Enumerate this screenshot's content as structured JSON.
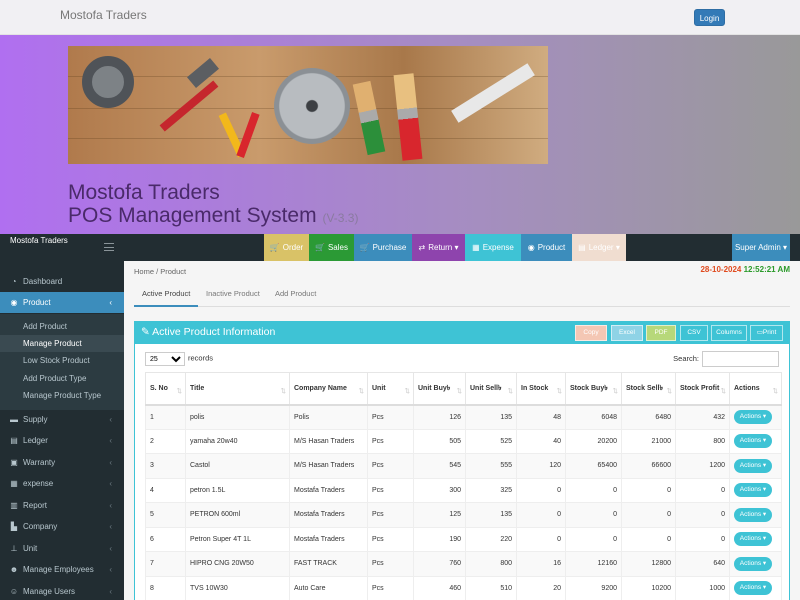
{
  "topbar": {
    "brand": "Mostofa Traders",
    "login_label": "Login"
  },
  "banner": {
    "title_line1": "Mostofa Traders",
    "title_line2": "POS Management System",
    "version": "(V-3.3)"
  },
  "navbar": {
    "app_name": "Mostofa Traders",
    "buttons": [
      {
        "label": "Order",
        "icon": "cart-icon",
        "color": "#d9c267"
      },
      {
        "label": "Sales",
        "icon": "cart-icon",
        "color": "#2b9a35"
      },
      {
        "label": "Purchase",
        "icon": "cart-icon",
        "color": "#3c8dbc"
      },
      {
        "label": "Return",
        "icon": "exchange-icon",
        "color": "#8e44ad"
      },
      {
        "label": "Expense",
        "icon": "calculator-icon",
        "color": "#3ec3d5"
      },
      {
        "label": "Product",
        "icon": "cube-icon",
        "color": "#3c8dbc"
      },
      {
        "label": "Ledger",
        "icon": "book-icon",
        "color": "#f0ddd0"
      }
    ],
    "user_label": "Super Admin"
  },
  "sidebar": {
    "items": [
      {
        "label": "Dashboard",
        "icon": "dashboard-icon"
      },
      {
        "label": "Product",
        "icon": "cube-icon"
      },
      {
        "label": "Supply",
        "icon": "truck-icon"
      },
      {
        "label": "Ledger",
        "icon": "book-icon"
      },
      {
        "label": "Warranty",
        "icon": "shield-icon"
      },
      {
        "label": "expense",
        "icon": "calculator-icon"
      },
      {
        "label": "Report",
        "icon": "chart-icon"
      },
      {
        "label": "Company",
        "icon": "building-icon"
      },
      {
        "label": "Unit",
        "icon": "unit-icon"
      },
      {
        "label": "Manage Employees",
        "icon": "users-icon"
      },
      {
        "label": "Manage Users",
        "icon": "user-icon"
      }
    ],
    "sub_items": [
      "Add Product",
      "Manage Product",
      "Low Stock Product",
      "Add Product Type",
      "Manage Product Type"
    ]
  },
  "content": {
    "breadcrumb": "Home / Product",
    "date": "28-10-2024",
    "time": "12:52:21 AM",
    "tabs": [
      "Active Product",
      "Inactive Product",
      "Add Product"
    ],
    "panel_title": "Active Product Information",
    "panel_buttons": [
      "Copy",
      "Excel",
      "PDF",
      "CSV",
      "Columns",
      "Print"
    ],
    "length_value": "25",
    "length_suffix": "records",
    "search_label": "Search:"
  },
  "table": {
    "columns": [
      "S. No",
      "Title",
      "Company Name",
      "Unit",
      "Unit Buy৳",
      "Unit Sell৳",
      "In Stock",
      "Stock Buy৳",
      "Stock Sell৳",
      "Stock Profit",
      "Actions"
    ],
    "action_label": "Actions",
    "rows": [
      [
        "1",
        "polis",
        "Polis",
        "Pcs",
        "126",
        "135",
        "48",
        "6048",
        "6480",
        "432"
      ],
      [
        "2",
        "yamaha 20w40",
        "M/S Hasan Traders",
        "Pcs",
        "505",
        "525",
        "40",
        "20200",
        "21000",
        "800"
      ],
      [
        "3",
        "Castol",
        "M/S Hasan Traders",
        "Pcs",
        "545",
        "555",
        "120",
        "65400",
        "66600",
        "1200"
      ],
      [
        "4",
        "petron 1.5L",
        "Mostafa Traders",
        "Pcs",
        "300",
        "325",
        "0",
        "0",
        "0",
        "0"
      ],
      [
        "5",
        "PETRON 600ml",
        "Mostafa Traders",
        "Pcs",
        "125",
        "135",
        "0",
        "0",
        "0",
        "0"
      ],
      [
        "6",
        "Petron Super 4T 1L",
        "Mostafa Traders",
        "Pcs",
        "190",
        "220",
        "0",
        "0",
        "0",
        "0"
      ],
      [
        "7",
        "HIPRO CNG 20W50",
        "FAST TRACK",
        "Pcs",
        "760",
        "800",
        "16",
        "12160",
        "12800",
        "640"
      ],
      [
        "8",
        "TVS 10W30",
        "Auto Care",
        "Pcs",
        "460",
        "510",
        "20",
        "9200",
        "10200",
        "1000"
      ]
    ]
  }
}
